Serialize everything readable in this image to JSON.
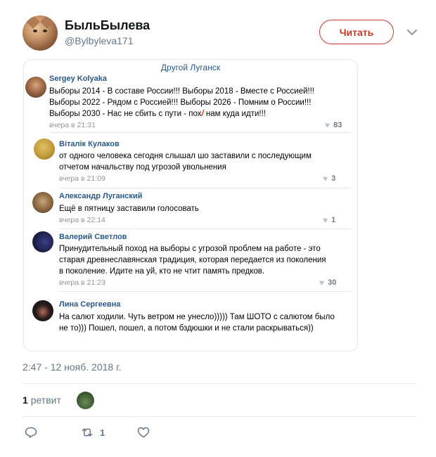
{
  "tweet": {
    "display_name": "БыльБылева",
    "handle": "@Bylbyleva171",
    "follow_label": "Читать",
    "timestamp": "2:47 - 12 нояб. 2018 г.",
    "retweets_count": "1",
    "retweets_label": "ретвит",
    "action_retweet_count": "1"
  },
  "card": {
    "group_title": "Другой Луганск",
    "comments": [
      {
        "name": "Sergey Kolyaka",
        "lines": [
          "Выборы 2014 - В составе России!!! Выборы 2018 - Вместе с Россией!!!",
          "Выборы 2022 - Рядом с Россией!!! Выборы 2026 - Помним о России!!!",
          "Выборы 2030 - Нас не сбить с пути - пох"
        ],
        "mark": "/",
        "line3_tail": " нам куда идти!!!",
        "date": "вчера в 21:31",
        "likes": "83"
      },
      {
        "name": "Віталік Кулаков",
        "lines": [
          "от одного человека сегодня слышал шо заставили с последующим",
          "отчетом начальству под угрозой увольнения"
        ],
        "date": "вчера в 21:09",
        "likes": "3"
      },
      {
        "name": "Александр Луганский",
        "lines": [
          "Ещё в пятницу заставили голосовать"
        ],
        "date": "вчера в 22:14",
        "likes": "1"
      },
      {
        "name": "Валерий Светлов",
        "lines": [
          "Принудительный поход на выборы с угрозой проблем на работе - это",
          "старая древнеславянская традиция, которая передается из поколения",
          "в поколение. Идите на  уй, кто не чтит память предков."
        ],
        "date": "вчера в 21:23",
        "likes": "30"
      },
      {
        "name": "Лина Сергеевна",
        "lines": [
          "На салют ходили. Чуть ветром не унесло))))) Там ШОТО с салютом было",
          "не то))) Пошел, пошел, а потом бздюшки и не стали раскрываться))"
        ]
      }
    ]
  },
  "colors": {
    "accent_red": "#c0392b",
    "vk_link": "#2a5885",
    "twitter_gray": "#657786"
  },
  "icons": [
    "chevron-down-icon",
    "heart-icon",
    "reply-icon",
    "retweet-icon",
    "like-icon"
  ]
}
